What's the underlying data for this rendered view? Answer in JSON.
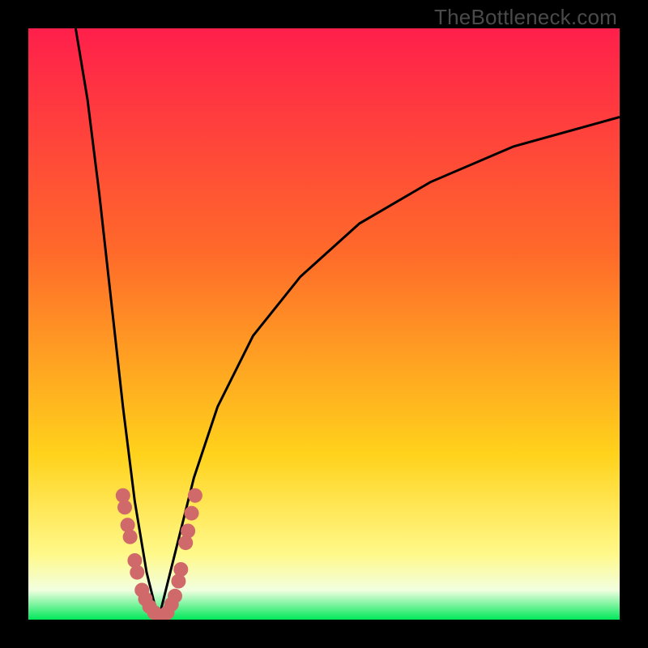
{
  "watermark": "TheBottleneck.com",
  "colors": {
    "top": "#ff1f4b",
    "mid_up": "#ff6a2a",
    "mid": "#ffd21b",
    "lo_band": "#fff98a",
    "pale": "#f2ffe0",
    "bottom": "#00e85a",
    "curve": "#000000",
    "dots": "#d06a6a"
  },
  "chart_data": {
    "type": "line",
    "title": "",
    "xlabel": "",
    "ylabel": "",
    "xlim": [
      0,
      100
    ],
    "ylim": [
      0,
      100
    ],
    "minimum_at_x": 22,
    "left_curve": [
      {
        "x": 8,
        "y": 100
      },
      {
        "x": 10,
        "y": 88
      },
      {
        "x": 12,
        "y": 72
      },
      {
        "x": 14,
        "y": 54
      },
      {
        "x": 16,
        "y": 36
      },
      {
        "x": 18,
        "y": 20
      },
      {
        "x": 20,
        "y": 8
      },
      {
        "x": 22,
        "y": 0
      }
    ],
    "right_curve": [
      {
        "x": 22,
        "y": 0
      },
      {
        "x": 25,
        "y": 12
      },
      {
        "x": 28,
        "y": 24
      },
      {
        "x": 32,
        "y": 36
      },
      {
        "x": 38,
        "y": 48
      },
      {
        "x": 46,
        "y": 58
      },
      {
        "x": 56,
        "y": 67
      },
      {
        "x": 68,
        "y": 74
      },
      {
        "x": 82,
        "y": 80
      },
      {
        "x": 100,
        "y": 85
      }
    ],
    "dot_cluster": [
      {
        "x": 16.0,
        "y": 21
      },
      {
        "x": 16.3,
        "y": 19
      },
      {
        "x": 16.8,
        "y": 16
      },
      {
        "x": 17.2,
        "y": 14
      },
      {
        "x": 18.0,
        "y": 10
      },
      {
        "x": 18.4,
        "y": 8
      },
      {
        "x": 19.2,
        "y": 5
      },
      {
        "x": 19.8,
        "y": 3.5
      },
      {
        "x": 20.5,
        "y": 2.2
      },
      {
        "x": 21.3,
        "y": 1.2
      },
      {
        "x": 22.0,
        "y": 0.7
      },
      {
        "x": 22.8,
        "y": 0.6
      },
      {
        "x": 23.5,
        "y": 1.2
      },
      {
        "x": 24.2,
        "y": 2.6
      },
      {
        "x": 24.8,
        "y": 4.0
      },
      {
        "x": 25.4,
        "y": 6.5
      },
      {
        "x": 25.8,
        "y": 8.5
      },
      {
        "x": 26.6,
        "y": 13
      },
      {
        "x": 27.0,
        "y": 15
      },
      {
        "x": 27.6,
        "y": 18
      },
      {
        "x": 28.2,
        "y": 21
      }
    ]
  }
}
